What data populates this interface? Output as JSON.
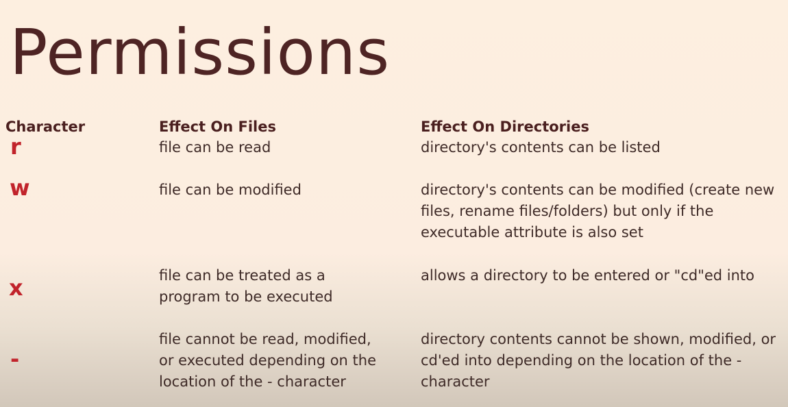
{
  "title": "Permissions",
  "headers": {
    "character": "Character",
    "files": "Effect On Files",
    "directories": "Effect On Directories"
  },
  "rows": [
    {
      "char": "r",
      "files": [
        "file can be read"
      ],
      "dirs": [
        "directory's contents can be listed"
      ]
    },
    {
      "char": "w",
      "files": [
        "file can be modified"
      ],
      "dirs": [
        "directory's contents can be modified (create new",
        "files, rename files/folders) but only if the",
        "executable attribute is also set"
      ]
    },
    {
      "char": "x",
      "files": [
        "file can be treated as a",
        "program to be executed"
      ],
      "dirs": [
        "allows a directory to be entered or \"cd\"ed into"
      ]
    },
    {
      "char": "-",
      "files": [
        "file cannot be read, modified,",
        "or executed depending on the",
        "location of the - character"
      ],
      "dirs": [
        "directory contents cannot be shown, modified, or",
        "cd'ed into depending on the location of the -",
        "character"
      ]
    }
  ]
}
